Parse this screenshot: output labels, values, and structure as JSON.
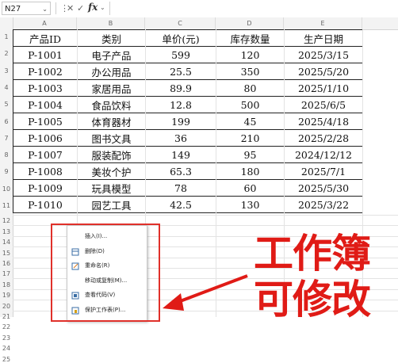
{
  "formula_bar": {
    "cell_ref": "N27",
    "fx": "fx",
    "formula": ""
  },
  "columns": [
    "A",
    "B",
    "C",
    "D",
    "E"
  ],
  "rows": [
    "1",
    "2",
    "3",
    "4",
    "5",
    "6",
    "7",
    "8",
    "9",
    "10",
    "11",
    "12",
    "13",
    "14",
    "15",
    "16",
    "17",
    "18",
    "19",
    "20",
    "21",
    "22",
    "23",
    "24",
    "25"
  ],
  "table": {
    "headers": [
      "产品ID",
      "类别",
      "单价(元)",
      "库存数量",
      "生产日期"
    ],
    "rows": [
      [
        "P-1001",
        "电子产品",
        "599",
        "120",
        "2025/3/15"
      ],
      [
        "P-1002",
        "办公用品",
        "25.5",
        "350",
        "2025/5/20"
      ],
      [
        "P-1003",
        "家居用品",
        "89.9",
        "80",
        "2025/1/10"
      ],
      [
        "P-1004",
        "食品饮料",
        "12.8",
        "500",
        "2025/6/5"
      ],
      [
        "P-1005",
        "体育器材",
        "199",
        "45",
        "2025/4/18"
      ],
      [
        "P-1006",
        "图书文具",
        "36",
        "210",
        "2025/2/28"
      ],
      [
        "P-1007",
        "服装配饰",
        "149",
        "95",
        "2024/12/12"
      ],
      [
        "P-1008",
        "美妆个护",
        "65.3",
        "180",
        "2025/7/1"
      ],
      [
        "P-1009",
        "玩具模型",
        "78",
        "60",
        "2025/5/30"
      ],
      [
        "P-1010",
        "园艺工具",
        "42.5",
        "130",
        "2025/3/22"
      ]
    ]
  },
  "context_menu": {
    "items": [
      {
        "label": "插入(I)...",
        "icon": "none"
      },
      {
        "label": "删除(D)",
        "icon": "delete-sheet-icon"
      },
      {
        "label": "重命名(R)",
        "icon": "rename-icon"
      },
      {
        "label": "移动或复制(M)...",
        "icon": "none"
      },
      {
        "label": "查看代码(V)",
        "icon": "view-code-icon"
      },
      {
        "label": "保护工作表(P)...",
        "icon": "protect-sheet-icon"
      }
    ]
  },
  "annotation": {
    "line1": "工作簿",
    "line2": "可修改",
    "color": "#e01b16"
  }
}
